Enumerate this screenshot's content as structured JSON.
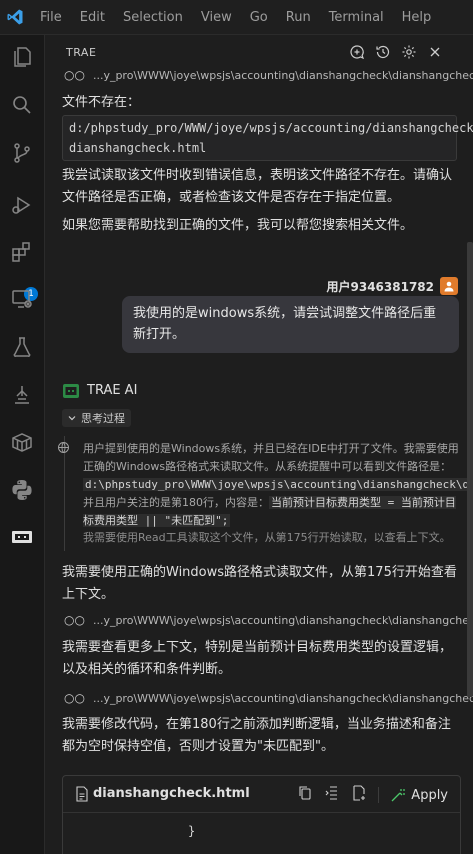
{
  "menu": [
    "File",
    "Edit",
    "Selection",
    "View",
    "Go",
    "Run",
    "Terminal",
    "Help"
  ],
  "activity_bar": {
    "extensions_badge": "1"
  },
  "panel": {
    "title": "TRAE"
  },
  "messages": {
    "path1": "...y_pro\\WWW\\joye\\wpsjs\\accounting\\dianshangcheck\\dianshangcheck.html",
    "file_not_exist_label": "文件不存在：",
    "code_path_line1": "d:/phpstudy_pro/WWW/joye/wpsjs/accounting/dianshangcheck/",
    "code_path_line2": "dianshangcheck.html",
    "para1": "我尝试读取该文件时收到错误信息，表明该文件路径不存在。请确认文件路径是否正确，或者检查该文件是否存在于指定位置。",
    "para2": "如果您需要帮助找到正确的文件，我可以帮您搜索相关文件。",
    "user_name": "用户9346381782",
    "user_message": "我使用的是windows系统，请尝试调整文件路径后重新打开。",
    "ai_name": "TRAE AI",
    "think_label": "思考过程",
    "think_text_part1": "用户提到使用的是Windows系统，并且已经在IDE中打开了文件。我需要使用正确的Windows路径格式来读取文件。从系统提醒中可以看到文件路径是：",
    "think_code_path": "d:\\phpstudy_pro\\WWW\\joye\\wpsjs\\accounting\\dianshangcheck\\dianshangcheck.html",
    "think_text_part2": "，并且用户关注的是第180行，内容是：",
    "think_code_line": "当前预计目标费用类型 = 当前预计目标费用类型 || \"未匹配到\";",
    "think_text2": "我需要使用Read工具读取这个文件，从第175行开始读取，以查看上下文。",
    "para3": "我需要使用正确的Windows路径格式读取文件，从第175行开始查看上下文。",
    "path2": "...y_pro\\WWW\\joye\\wpsjs\\accounting\\dianshangcheck\\dianshangcheck.html",
    "para4": "我需要查看更多上下文，特别是当前预计目标费用类型的设置逻辑，以及相关的循环和条件判断。",
    "path3": "...y_pro\\WWW\\joye\\wpsjs\\accounting\\dianshangcheck\\dianshangcheck.html",
    "para5": "我需要修改代码，在第180行之前添加判断逻辑，当业务描述和备注都为空时保持空值，否则才设置为\"未匹配到\"。"
  },
  "file_card": {
    "file_name": "dianshangcheck.html",
    "apply_label": "Apply",
    "code_line": "}"
  },
  "colors": {
    "accent_blue": "#0078d4",
    "ai_green": "#2c8a45",
    "user_orange": "#e07b2c"
  }
}
